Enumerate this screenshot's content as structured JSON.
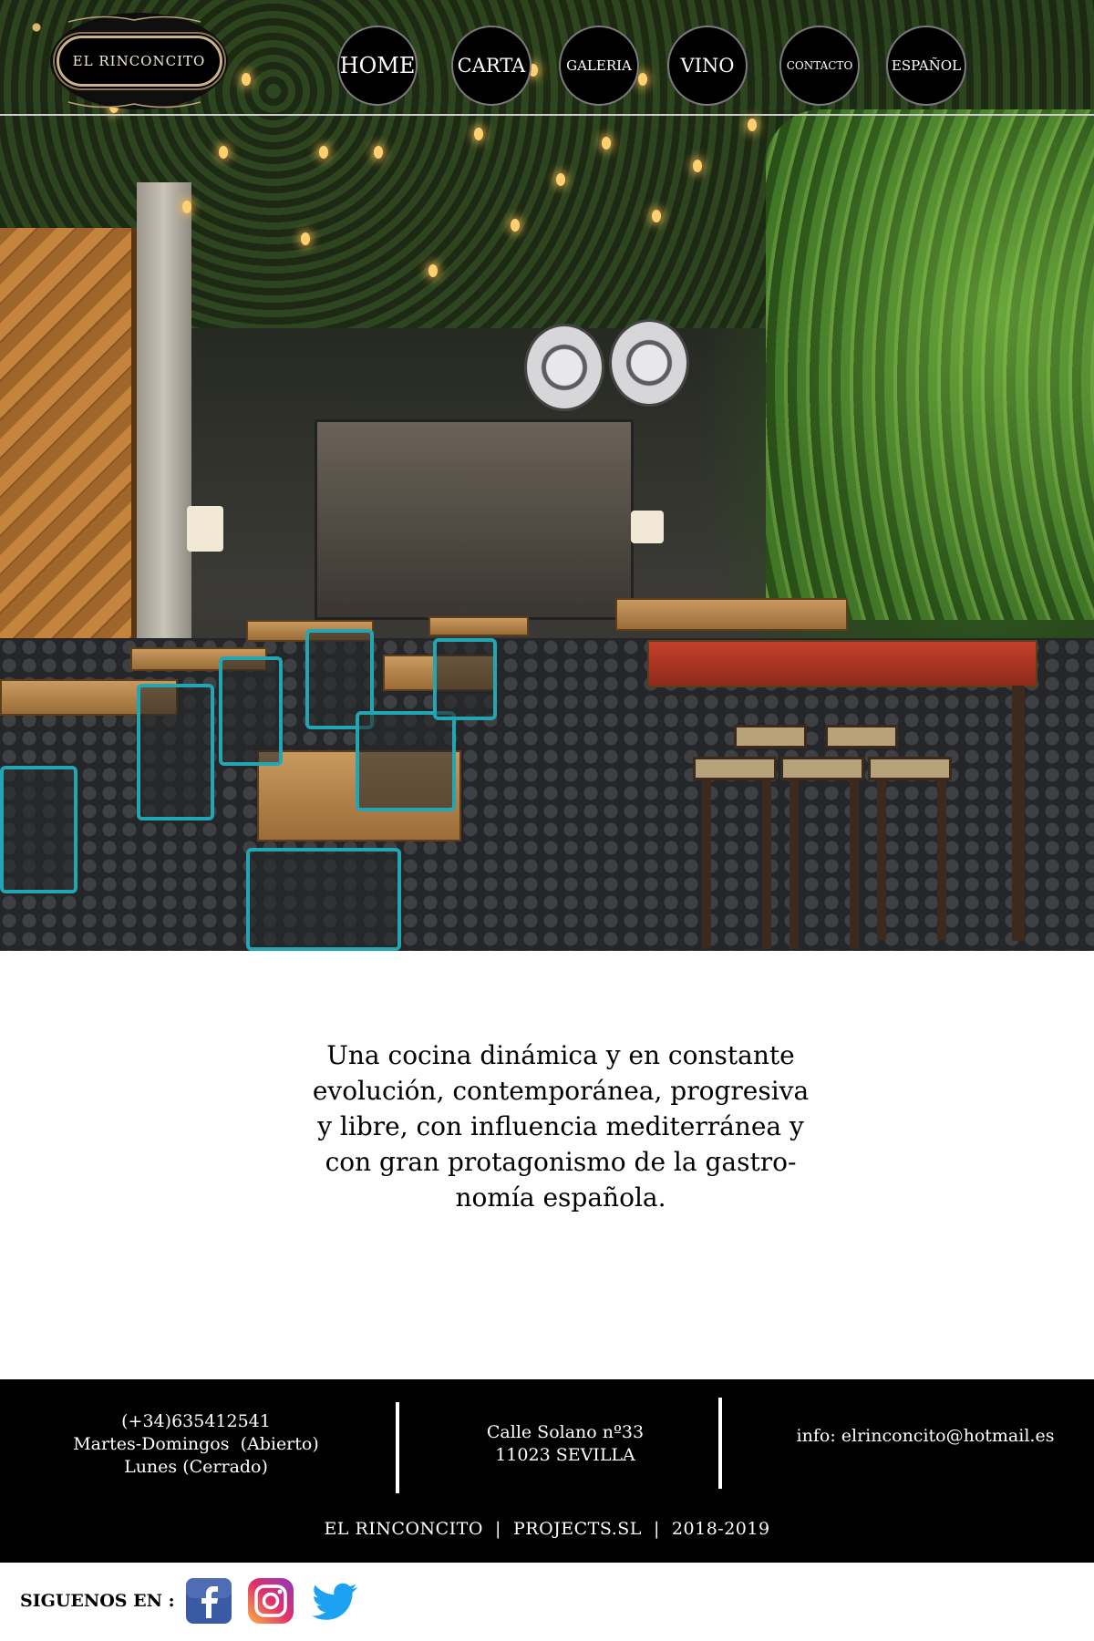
{
  "brand": {
    "name": "EL RINCONCITO"
  },
  "nav": {
    "items": [
      {
        "label": "HOME"
      },
      {
        "label": "CARTA"
      },
      {
        "label": "GALERIA"
      },
      {
        "label": "VINO"
      },
      {
        "label": "CONTACTO"
      },
      {
        "label": "ESPAÑOL"
      }
    ]
  },
  "hero": {
    "image_alt_icon": "restaurant-interior-photo"
  },
  "intro": {
    "text": "Una cocina dinámica y en constante\nevolución, contemporánea, progresiva\ny libre, con influencia mediterránea y\ncon gran protagonismo de la gastro-\nnomía española."
  },
  "footer": {
    "phone": "(+34)635412541",
    "hours_open": "Martes-Domingos  (Abierto)",
    "hours_closed": "Lunes (Cerrado)",
    "address_line1": "Calle Solano nº33",
    "address_line2": "11023 SEVILLA",
    "email": "info: elrinconcito@hotmail.es",
    "copyright": "EL RINCONCITO  |  PROJECTS.SL  |  2018-2019"
  },
  "social": {
    "label": "SIGUENOS EN :",
    "icons": [
      "facebook-icon",
      "instagram-icon",
      "twitter-icon"
    ]
  },
  "colors": {
    "facebook": "#3b5aa5",
    "instagram_start": "#f9b542",
    "instagram_end": "#c0269d",
    "twitter": "#1da1f2",
    "chair_teal": "#23a5b2"
  }
}
